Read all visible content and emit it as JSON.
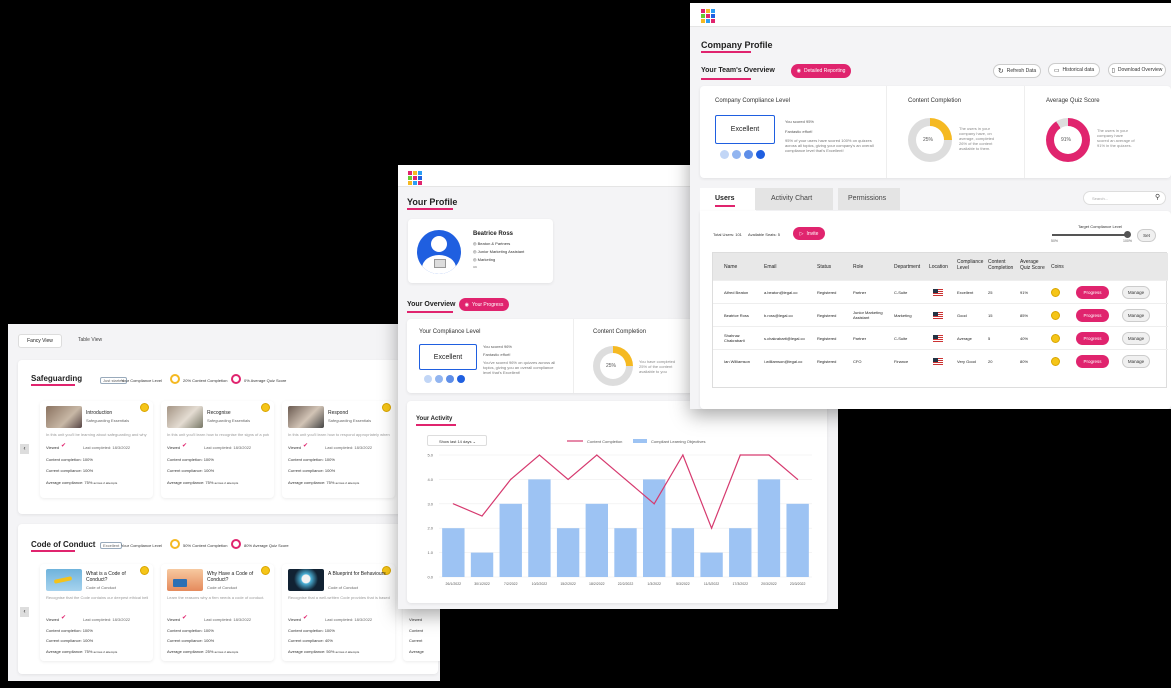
{
  "left": {
    "tabs": [
      "Fancy View",
      "Table View"
    ],
    "sections": [
      {
        "title": "Safeguarding",
        "badge": "Just started",
        "compliance_label": "Your Compliance Level",
        "stat1": "20% Content Completion",
        "stat2": "0% Average Quiz Score",
        "cards": [
          {
            "title": "Introduction",
            "sub": "Safeguarding Essentials",
            "desc": "In this unit you'll be learning about safeguarding and why it is important.",
            "viewed": "Viewed",
            "last": "Last completed: 18/3/2022",
            "cc": "Content completion: 100%",
            "cur": "Current compliance: 100%",
            "avg": "Average compliance: 75%",
            "avg_suffix": "across 2 attempts"
          },
          {
            "title": "Recognise",
            "sub": "Safeguarding Essentials",
            "desc": "In this unit you'll learn how to recognise the signs of a potential safeguarding concern.",
            "viewed": "Viewed",
            "last": "Last completed: 18/3/2022",
            "cc": "Content completion: 100%",
            "cur": "Current compliance: 100%",
            "avg": "Average compliance: 75%",
            "avg_suffix": "across 2 attempts"
          },
          {
            "title": "Respond",
            "sub": "Safeguarding Essentials",
            "desc": "In this unit you'll learn how to respond appropriately when you have concerns about a safeguarding incident.",
            "viewed": "Viewed",
            "last": "Last completed: 18/3/2022",
            "cc": "Content completion: 100%",
            "cur": "Current compliance: 100%",
            "avg": "Average compliance: 75%",
            "avg_suffix": "across 2 attempts"
          }
        ]
      },
      {
        "title": "Code of Conduct",
        "badge": "Excellent",
        "compliance_label": "Your Compliance Level",
        "stat1": "50% Content Completion",
        "stat2": "80% Average Quiz Score",
        "cards": [
          {
            "title": "What is a Code of Conduct?",
            "sub": "Code of Conduct",
            "desc": "Recognise that the Code contains our deepest ethical beliefs standards, and serves as our guide for making ethical decisions.",
            "viewed": "Viewed",
            "last": "Last completed: 18/3/2022",
            "cc": "Content completion: 100%",
            "cur": "Current compliance: 100%",
            "avg": "Average compliance: 75%",
            "avg_suffix": "across 2 attempts"
          },
          {
            "title": "Why Have a Code of Conduct?",
            "sub": "Code of Conduct",
            "desc": "Learn the reasons why a firm needs a code of conduct.",
            "viewed": "Viewed",
            "last": "Last completed: 18/3/2022",
            "cc": "Content completion: 100%",
            "cur": "Current compliance: 100%",
            "avg": "Average compliance: 25%",
            "avg_suffix": "across 2 attempts"
          },
          {
            "title": "A Blueprint for Behaviours",
            "sub": "Code of Conduct",
            "desc": "Recognise that a well-written Code provides that is based a set of values and principles to which all employees are held.",
            "viewed": "Viewed",
            "last": "Last completed: 18/3/2022",
            "cc": "Content completion: 100%",
            "cur": "Current compliance: 40%",
            "avg": "Average compliance: 50%",
            "avg_suffix": "across 2 attempts"
          }
        ],
        "partial": [
          "Viewed",
          "Content",
          "Current",
          "Average"
        ]
      }
    ]
  },
  "middle": {
    "page_title": "Your Profile",
    "profile": {
      "name": "Beatrice Ross",
      "company": "Beaton & Partners",
      "role": "Junior Marketing Assistant",
      "dept": "Marketing",
      "country": "UK"
    },
    "overview_title": "Your Overview",
    "overview_btn": "Your Progress",
    "compliance_title": "Your Compliance Level",
    "excellent": "Excellent",
    "scored": "You scored 96%",
    "fantastic": "Fantastic effort!",
    "scored_desc": "You've scored 96% on quizzes across all topics, giving you an overall compliance level that's Excellent!",
    "completion_title": "Content Completion",
    "completion_pct": "25%",
    "completion_desc": "You have completed 25% of the content available to you",
    "activity_title": "Your Activity",
    "range": "Show last 14 days",
    "chart_data": {
      "type": "bar+line",
      "legend_line": "Content Completion",
      "legend_bar": "Compliant Learning Objectives",
      "ylim": [
        0,
        5
      ],
      "yticks": [
        "0.0",
        "1.0",
        "2.0",
        "3.0",
        "4.0",
        "5.0"
      ],
      "categories": [
        "26/1/2022",
        "30/1/2022",
        "7/2/2022",
        "10/2/2022",
        "15/2/2022",
        "18/2/2022",
        "22/2/2022",
        "1/3/2022",
        "5/3/2022",
        "11/3/2022",
        "17/3/2022",
        "20/3/2022",
        "23/3/2022"
      ],
      "bars": [
        2.0,
        1.0,
        3.0,
        4.0,
        2.0,
        3.0,
        2.0,
        4.0,
        2.0,
        1.0,
        2.0,
        4.0,
        3.0
      ],
      "line": [
        3.0,
        2.5,
        4.0,
        5.0,
        4.0,
        5.0,
        4.0,
        3.0,
        5.0,
        2.0,
        5.0,
        5.0,
        4.0
      ]
    }
  },
  "right": {
    "page_title": "Company Profile",
    "team_title": "Your Team's Overview",
    "detailed_btn": "Detailed Reporting",
    "refresh_btn": "Refresh Data",
    "historical_btn": "Historical data",
    "download_btn": "Download Overview",
    "comp_title": "Company Compliance Level",
    "excellent": "Excellent",
    "scored": "You scored 95%",
    "fantastic": "Fantastic effort!",
    "scored_desc": "95% of your users have scored 100% on quizzes across all topics, giving your company's an overall compliance level that's Excellent!",
    "completion_title": "Content Completion",
    "completion_pct": "25%",
    "completion_desc": "The users in your company have, on average, completed 26% of the content available to them.",
    "quiz_title": "Average Quiz Score",
    "quiz_pct": "91%",
    "quiz_desc": "The users in your company have scored an average of 91% in the quizzes.",
    "tabs": [
      "Users",
      "Activity Chart",
      "Permissions"
    ],
    "search_placeholder": "Search...",
    "total_users": "Total Users: 101",
    "available": "Available Seats: 5",
    "invite": "Invite",
    "target": "Target Compliance Level",
    "target_min": "50%",
    "target_max": "100%",
    "set": "Set",
    "columns": [
      "Name",
      "Email",
      "Status",
      "Role",
      "Department",
      "Location",
      "Compliance Level",
      "Content Completion",
      "Average Quiz Score",
      "Coins"
    ],
    "rows": [
      {
        "name": "Alfred Beaton",
        "email": "a.beaton@legal.co",
        "status": "Registered",
        "role": "Partner",
        "dept": "C-Suite",
        "level": "Excellent",
        "cc": "25",
        "quiz": "91%"
      },
      {
        "name": "Beatrice Ross",
        "email": "b.ross@legal.co",
        "status": "Registered",
        "role": "Junior Marketing Assistant",
        "dept": "Marketing",
        "level": "Good",
        "cc": "15",
        "quiz": "85%"
      },
      {
        "name": "Shahnaz Chakrabarti",
        "email": "s.chakrabarti@legal.co",
        "status": "Registered",
        "role": "Partner",
        "dept": "C-Suite",
        "level": "Average",
        "cc": "5",
        "quiz": "40%"
      },
      {
        "name": "Ian Williamson",
        "email": "i.williamson@legal.co",
        "status": "Registered",
        "role": "CFO",
        "dept": "Finance",
        "level": "Very Good",
        "cc": "20",
        "quiz": "80%"
      }
    ],
    "progress_btn": "Progress",
    "manage_btn": "Manage"
  },
  "colors": {
    "accent": "#e0246e",
    "blue": "#1f5fe0",
    "yellow": "#f5b922",
    "bar": "#9dc3f3",
    "line": "#d63a6f"
  }
}
